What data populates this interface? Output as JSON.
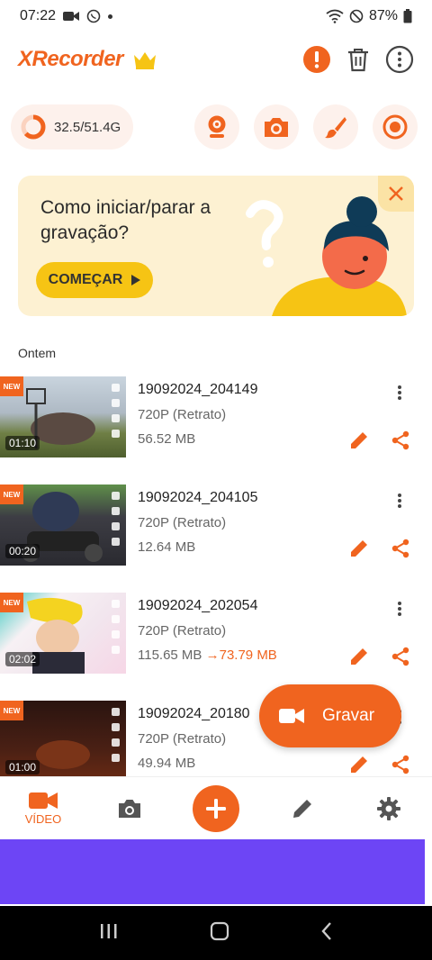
{
  "status_bar": {
    "time": "07:22",
    "battery": "87%"
  },
  "header": {
    "app_name": "XRecorder"
  },
  "storage": {
    "usage": "32.5/51.4G",
    "used_fraction": 0.63
  },
  "banner": {
    "title": "Como iniciar/parar a gravação?",
    "button_label": "COMEÇAR"
  },
  "section": {
    "label": "Ontem"
  },
  "videos": [
    {
      "badge": "NEW",
      "name": "19092024_204149",
      "resolution": "720P (Retrato)",
      "size": "56.52 MB",
      "duration": "01:10"
    },
    {
      "badge": "NEW",
      "name": "19092024_204105",
      "resolution": "720P (Retrato)",
      "size": "12.64 MB",
      "duration": "00:20"
    },
    {
      "badge": "NEW",
      "name": "19092024_202054",
      "resolution": "720P (Retrato)",
      "size": "115.65 MB",
      "compressed_size": "73.79 MB",
      "duration": "02:02"
    },
    {
      "badge": "NEW",
      "name": "19092024_20180",
      "resolution": "720P (Retrato)",
      "size": "49.94 MB",
      "duration": "01:00"
    }
  ],
  "fab": {
    "label": "Gravar"
  },
  "bottom_nav": {
    "video_label": "VÍDEO"
  },
  "colors": {
    "accent": "#f0641f",
    "banner_bg": "#fdf1d2",
    "banner_button": "#f6c414",
    "ad_bar": "#6d45f5"
  }
}
